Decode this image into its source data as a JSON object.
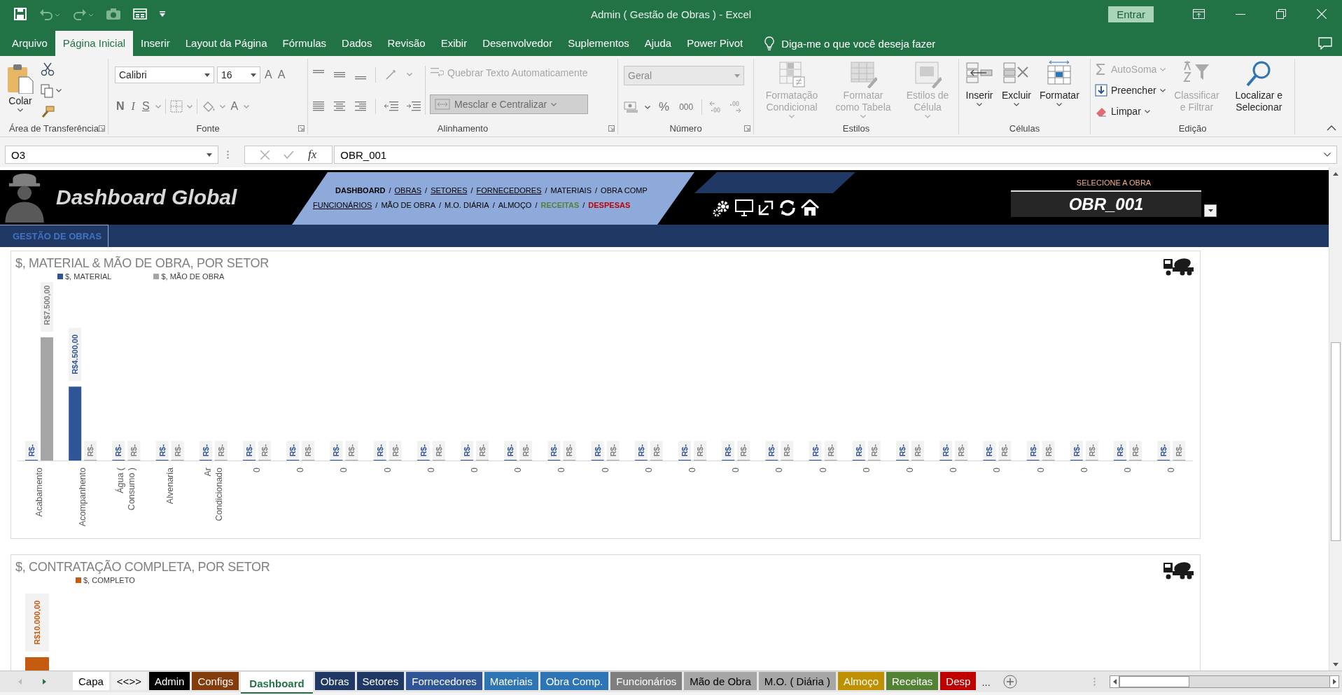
{
  "window": {
    "title": "Admin ( Gestão de Obras )  -  Excel",
    "sign_in": "Entrar"
  },
  "menu_tabs": [
    {
      "label": "Arquivo",
      "selected": false
    },
    {
      "label": "Página Inicial",
      "selected": true
    },
    {
      "label": "Inserir",
      "selected": false
    },
    {
      "label": "Layout da Página",
      "selected": false
    },
    {
      "label": "Fórmulas",
      "selected": false
    },
    {
      "label": "Dados",
      "selected": false
    },
    {
      "label": "Revisão",
      "selected": false
    },
    {
      "label": "Exibir",
      "selected": false
    },
    {
      "label": "Desenvolvedor",
      "selected": false
    },
    {
      "label": "Suplementos",
      "selected": false
    },
    {
      "label": "Ajuda",
      "selected": false
    },
    {
      "label": "Power Pivot",
      "selected": false
    }
  ],
  "tell_me": {
    "placeholder": "Diga-me o que você deseja fazer"
  },
  "ribbon": {
    "clipboard": {
      "label": "Área de Transferência",
      "paste": "Colar"
    },
    "font": {
      "label": "Fonte",
      "font_name": "Calibri",
      "font_size": "16",
      "grow": "A",
      "shrink": "A",
      "bold": "N",
      "italic": "I",
      "underline": "S",
      "font_color": "A"
    },
    "alignment": {
      "label": "Alinhamento",
      "wrap_text": {
        "label": "Quebrar Texto Automaticamente",
        "disabled": true
      },
      "merge": {
        "label": "Mesclar e Centralizar",
        "disabled": true
      }
    },
    "number": {
      "label": "Número",
      "format": {
        "value": "Geral",
        "disabled": true
      },
      "percent": "%",
      "thousands": "000"
    },
    "styles": {
      "label": "Estilos",
      "buttons": [
        {
          "label": "Formatação Condicional",
          "kind": "conditional",
          "disabled": true
        },
        {
          "label": "Formatar como Tabela",
          "kind": "table",
          "disabled": true
        },
        {
          "label": "Estilos de Célula",
          "kind": "cellstyle",
          "disabled": true
        }
      ]
    },
    "cells": {
      "label": "Células",
      "buttons": [
        {
          "label": "Inserir",
          "kind": "insert",
          "disabled": false
        },
        {
          "label": "Excluir",
          "kind": "delete",
          "disabled": false
        },
        {
          "label": "Formatar",
          "kind": "format",
          "disabled": false
        }
      ]
    },
    "editing": {
      "label": "Edição",
      "items": [
        {
          "label": "AutoSoma",
          "kind": "sum",
          "disabled": true
        },
        {
          "label": "Preencher",
          "kind": "fill",
          "disabled": false
        },
        {
          "label": "Limpar",
          "kind": "clear",
          "disabled": false
        }
      ],
      "buttons": [
        {
          "label": "Classificar e Filtrar",
          "kind": "sort",
          "disabled": true
        },
        {
          "label": "Localizar e Selecionar",
          "kind": "find",
          "disabled": false
        }
      ]
    }
  },
  "formula_bar": {
    "name_box": "O3",
    "fx": "fx",
    "value": "OBR_001"
  },
  "dashboard": {
    "title": "Dashboard Global",
    "separator": "/",
    "nav_rows": [
      [
        {
          "label": "DASHBOARD",
          "kind": "current"
        },
        {
          "label": "OBRAS",
          "kind": "link"
        },
        {
          "label": "SETORES",
          "kind": "link"
        },
        {
          "label": "FORNECEDORES",
          "kind": "link"
        },
        {
          "label": "MATERIAIS",
          "kind": "plain"
        },
        {
          "label": "OBRA COMP",
          "kind": "plain"
        }
      ],
      [
        {
          "label": "FUNCIONÁRIOS",
          "kind": "link"
        },
        {
          "label": "MÃO DE OBRA",
          "kind": "plain"
        },
        {
          "label": "M.O. DIÁRIA",
          "kind": "plain"
        },
        {
          "label": "ALMOÇO",
          "kind": "plain"
        },
        {
          "label": "RECEITAS",
          "kind": "income"
        },
        {
          "label": "DESPESAS",
          "kind": "expense"
        }
      ]
    ],
    "selector": {
      "label": "SELECIONE A OBRA",
      "value": "OBR_001"
    },
    "section": "GESTÃO DE OBRAS"
  },
  "charts": [
    {
      "chart_data": {
        "type": "bar",
        "title": "$, MATERIAL & MÃO DE OBRA, POR SETOR",
        "categories": [
          "Acabamento",
          "Acompanhento",
          "Água ( Consumo )",
          "Alvenaria",
          "Ar Condicionado",
          "0",
          "0",
          "0",
          "0",
          "0",
          "0",
          "0",
          "0",
          "0",
          "0",
          "0",
          "0",
          "0",
          "0",
          "0",
          "0",
          "0",
          "0",
          "0",
          "0",
          "0",
          "0"
        ],
        "series": [
          {
            "name": "$, MATERIAL",
            "color": "#2f5597",
            "values": [
              0,
              4500,
              0,
              0,
              0,
              0,
              0,
              0,
              0,
              0,
              0,
              0,
              0,
              0,
              0,
              0,
              0,
              0,
              0,
              0,
              0,
              0,
              0,
              0,
              0,
              0,
              0
            ],
            "value_labels": [
              "R$-",
              "R$4.500,00",
              "R$-",
              "R$-",
              "R$-",
              "R$-",
              "R$-",
              "R$-",
              "R$-",
              "R$-",
              "R$-",
              "R$-",
              "R$-",
              "R$-",
              "R$-",
              "R$-",
              "R$-",
              "R$-",
              "R$-",
              "R$-",
              "R$-",
              "R$-",
              "R$-",
              "R$-",
              "R$-",
              "R$-",
              "R$-"
            ]
          },
          {
            "name": "$, MÃO DE OBRA",
            "color": "#a5a5a5",
            "values": [
              7500,
              0,
              0,
              0,
              0,
              0,
              0,
              0,
              0,
              0,
              0,
              0,
              0,
              0,
              0,
              0,
              0,
              0,
              0,
              0,
              0,
              0,
              0,
              0,
              0,
              0,
              0
            ],
            "value_labels": [
              "R$7.500,00",
              "R$-",
              "R$-",
              "R$-",
              "R$-",
              "R$-",
              "R$-",
              "R$-",
              "R$-",
              "R$-",
              "R$-",
              "R$-",
              "R$-",
              "R$-",
              "R$-",
              "R$-",
              "R$-",
              "R$-",
              "R$-",
              "R$-",
              "R$-",
              "R$-",
              "R$-",
              "R$-",
              "R$-",
              "R$-",
              "R$-"
            ]
          }
        ]
      }
    },
    {
      "chart_data": {
        "type": "bar",
        "title": "$, CONTRATAÇÃO COMPLETA, POR SETOR",
        "series": [
          {
            "name": "$, COMPLETO",
            "color": "#c55a11",
            "values": [
              10000
            ],
            "value_labels": [
              "R$10.000,00"
            ]
          }
        ]
      }
    }
  ],
  "sheet_tabs": [
    {
      "label": "Capa",
      "color": "#ffffff",
      "selected": false
    },
    {
      "label": "<<>>",
      "color": "#f0f0f0",
      "selected": false
    },
    {
      "label": "Admin",
      "color": "#000000",
      "selected": false
    },
    {
      "label": "Configs",
      "color": "#843c0c",
      "selected": false
    },
    {
      "label": "Dashboard",
      "color": "#ffffff",
      "selected": true
    },
    {
      "label": "Obras",
      "color": "#1f3864",
      "selected": false
    },
    {
      "label": "Setores",
      "color": "#203864",
      "selected": false
    },
    {
      "label": "Fornecedores",
      "color": "#2f5597",
      "selected": false
    },
    {
      "label": "Materiais",
      "color": "#2e75b6",
      "selected": false
    },
    {
      "label": "Obra Comp.",
      "color": "#2e75b6",
      "selected": false
    },
    {
      "label": "Funcionários",
      "color": "#7f7f7f",
      "selected": false
    },
    {
      "label": "Mão de Obra",
      "color": "#a6a6a6",
      "selected": false
    },
    {
      "label": "M.O. ( Diária )",
      "color": "#a6a6a6",
      "selected": false
    },
    {
      "label": "Almoço",
      "color": "#bf9000",
      "selected": false
    },
    {
      "label": "Receitas",
      "color": "#548235",
      "selected": false
    },
    {
      "label": "Desp",
      "color": "#c00000",
      "selected": false
    }
  ],
  "more_tabs": "..."
}
